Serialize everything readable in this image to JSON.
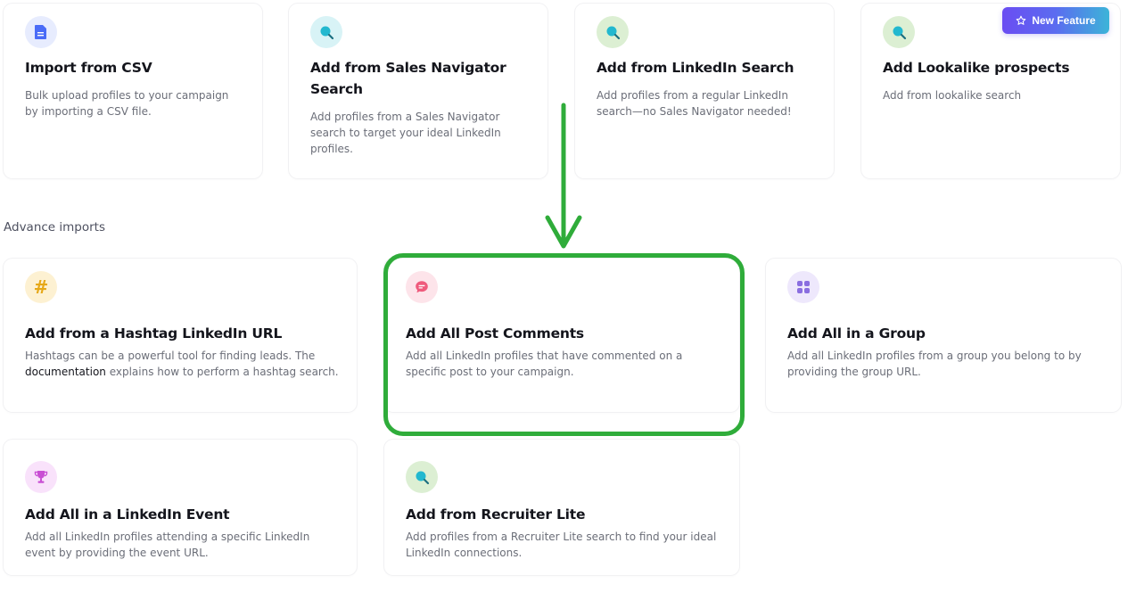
{
  "badge": {
    "label": "New Feature",
    "icon": "star-icon"
  },
  "section": {
    "advance_label": "Advance imports"
  },
  "top_cards": [
    {
      "title": "Import from CSV",
      "description": "Bulk upload profiles to your campaign by importing a CSV file.",
      "icon": "document-icon",
      "icon_color": "#4a6cf7",
      "icon_bg": "#e7ecfe"
    },
    {
      "title": "Add from Sales Navigator Search",
      "description": "Add profiles from a Sales Navigator search to target your ideal LinkedIn profiles.",
      "icon": "search-icon",
      "icon_color": "#22b8cf",
      "icon_bg": "#d8f3f6"
    },
    {
      "title": "Add from LinkedIn Search",
      "description": "Add profiles from a regular LinkedIn search—no Sales Navigator needed!",
      "icon": "search-icon",
      "icon_color": "#22b8cf",
      "icon_bg": "#dcefd3"
    },
    {
      "title": "Add Lookalike prospects",
      "description": "Add from lookalike search",
      "icon": "search-icon",
      "icon_color": "#22b8cf",
      "icon_bg": "#dcefd3"
    }
  ],
  "advance_cards": [
    {
      "title": "Add from a Hashtag LinkedIn URL",
      "description_before": "Hashtags can be a powerful tool for finding leads. The ",
      "link": "documentation",
      "description_after": " explains how to perform a hashtag search.",
      "icon": "hashtag-icon",
      "icon_color": "#e6a817",
      "icon_bg": "#fdf1d2"
    },
    {
      "title": "Add All Post Comments",
      "description": "Add all LinkedIn profiles that have commented on a specific post to your campaign.",
      "icon": "comment-icon",
      "icon_color": "#ef5a7c",
      "icon_bg": "#fde4ea"
    },
    {
      "title": "Add All in a Group",
      "description": "Add all LinkedIn profiles from a group you belong to by providing the group URL.",
      "icon": "grid-icon",
      "icon_color": "#8a6ee0",
      "icon_bg": "#eee8fc"
    },
    {
      "title": "Add All in a LinkedIn Event",
      "description": "Add all LinkedIn profiles attending a specific LinkedIn event by providing the event URL.",
      "icon": "trophy-icon",
      "icon_color": "#c94fd4",
      "icon_bg": "#f9e2fb"
    },
    {
      "title": "Add from Recruiter Lite",
      "description": "Add profiles from a Recruiter Lite search to find your ideal LinkedIn connections.",
      "icon": "search-icon",
      "icon_color": "#22b8cf",
      "icon_bg": "#dcefd3"
    }
  ],
  "colors": {
    "annotation_green": "#2fac3a",
    "badge_gradient_start": "#6a4df2",
    "badge_gradient_end": "#3cb4d8"
  }
}
